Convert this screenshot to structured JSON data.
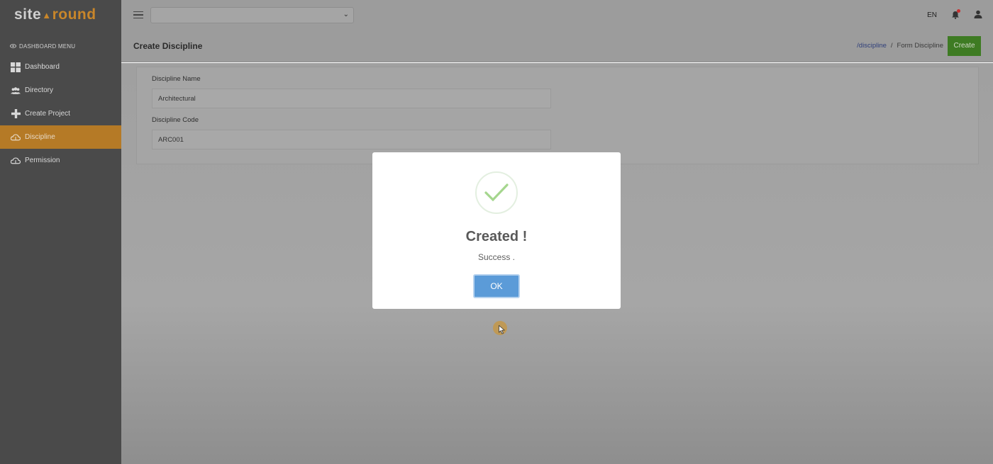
{
  "brand": {
    "site": "site",
    "round": "round"
  },
  "sidebar": {
    "heading": "DASHBOARD MENU",
    "items": [
      {
        "label": "Dashboard",
        "icon": "dashboard-icon"
      },
      {
        "label": "Directory",
        "icon": "users-icon"
      },
      {
        "label": "Create Project",
        "icon": "plus-icon"
      },
      {
        "label": "Discipline",
        "icon": "cloud-icon",
        "active": true
      },
      {
        "label": "Permission",
        "icon": "cloud-icon"
      }
    ]
  },
  "topbar": {
    "project_select_value": "",
    "language": "EN"
  },
  "header": {
    "title": "Create Discipline",
    "breadcrumb_link": "/discipline",
    "breadcrumb_sep": "/",
    "breadcrumb_current": "Form Discipline",
    "create_label": "Create"
  },
  "form": {
    "name_label": "Discipline Name",
    "name_value": "Architectural",
    "code_label": "Discipline Code",
    "code_value": "ARC001"
  },
  "modal": {
    "title": "Created !",
    "message": "Success .",
    "ok_label": "OK"
  },
  "colors": {
    "sidebar_bg": "#4a4a4a",
    "active_item": "#b57a26",
    "create_button": "#3e7b23",
    "ok_button": "#5b9bd8",
    "success_check": "#a5d68e"
  }
}
